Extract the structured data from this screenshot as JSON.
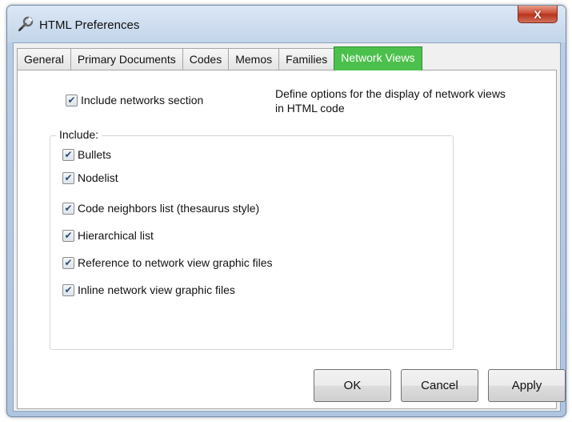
{
  "window": {
    "title": "HTML Preferences",
    "close_label": "X",
    "icon": "wrench-plug-icon"
  },
  "tabs": [
    {
      "label": "General",
      "active": false
    },
    {
      "label": "Primary Documents",
      "active": false
    },
    {
      "label": "Codes",
      "active": false
    },
    {
      "label": "Memos",
      "active": false
    },
    {
      "label": "Families",
      "active": false
    },
    {
      "label": "Network Views",
      "active": true
    }
  ],
  "network_views": {
    "include_networks": {
      "label": "Include networks section",
      "checked": true
    },
    "description": "Define options for the display of network views in HTML code",
    "group_label": "Include:",
    "options": [
      {
        "label": "Bullets",
        "checked": true
      },
      {
        "label": "Nodelist",
        "checked": true
      },
      {
        "label": "Code neighbors list (thesaurus style)",
        "checked": true
      },
      {
        "label": "Hierarchical list",
        "checked": true
      },
      {
        "label": "Reference to network view graphic files",
        "checked": true
      },
      {
        "label": "Inline network view graphic files",
        "checked": true
      }
    ]
  },
  "buttons": {
    "ok": "OK",
    "cancel": "Cancel",
    "apply": "Apply"
  },
  "colors": {
    "active_tab": "#4cc04c",
    "close_button": "#c8452b",
    "window_frame": "#b8cde6"
  }
}
